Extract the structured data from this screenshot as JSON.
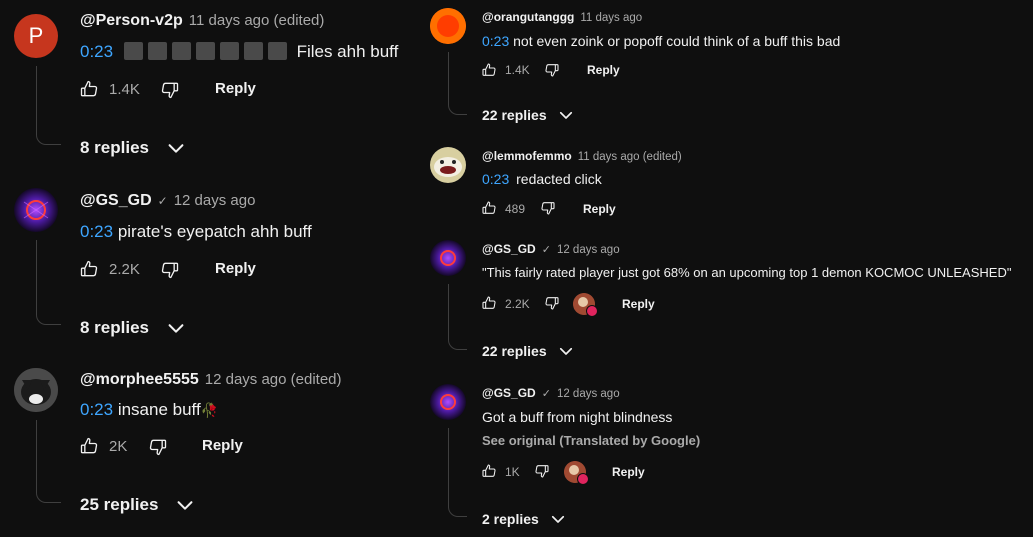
{
  "left": [
    {
      "author": "@Person-v2p",
      "date": "11 days ago (edited)",
      "verified": false,
      "timestamp": "0:23",
      "text": "Files ahh buff",
      "likes": "1.4K",
      "reply_label": "Reply",
      "replies": "8 replies",
      "avatar_letter": "P"
    },
    {
      "author": "@GS_GD",
      "date": "12 days ago",
      "verified": true,
      "timestamp": "0:23",
      "text": "pirate's eyepatch ahh buff",
      "likes": "2.2K",
      "reply_label": "Reply",
      "replies": "8 replies"
    },
    {
      "author": "@morphee5555",
      "date": "12 days ago (edited)",
      "verified": false,
      "timestamp": "0:23",
      "text": "insane buff",
      "emoji": "🥀",
      "likes": "2K",
      "reply_label": "Reply",
      "replies": "25 replies"
    }
  ],
  "right": [
    {
      "author": "@orangutanggg",
      "date": "11 days ago",
      "timestamp": "0:23",
      "text": "not even zoink or popoff could think of a buff this bad",
      "likes": "1.4K",
      "reply_label": "Reply",
      "replies": "22 replies"
    },
    {
      "author": "@lemmofemmo",
      "date": "11 days ago (edited)",
      "timestamp": "0:23",
      "text": "redacted click",
      "likes": "489",
      "reply_label": "Reply"
    },
    {
      "author": "@GS_GD",
      "date": "12 days ago",
      "verified": true,
      "text": "\"This fairly rated player just got 68% on an upcoming top 1 demon KOCMOC UNLEASHED\"",
      "likes": "2.2K",
      "reply_label": "Reply",
      "replies": "22 replies"
    },
    {
      "author": "@GS_GD",
      "date": "12 days ago",
      "verified": true,
      "text": "Got a buff from night blindness",
      "see_original": "See original (Translated by Google)",
      "likes": "1K",
      "reply_label": "Reply",
      "replies": "2 replies"
    }
  ],
  "colors": {
    "background": "#0f0f0f",
    "timestamp": "#3ea6ff",
    "avatar_p": "#c6361e",
    "avatar_orange": "#ff6f00"
  },
  "icons": {
    "like": "thumb-up-icon",
    "dislike": "thumb-down-icon",
    "expand": "chevron-down-icon",
    "verified": "check-icon"
  }
}
